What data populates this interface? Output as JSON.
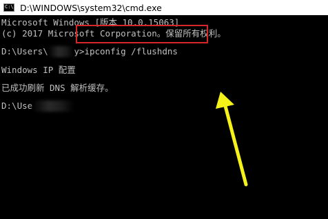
{
  "window": {
    "title": "D:\\WINDOWS\\system32\\cmd.exe",
    "icon": "cmd-icon"
  },
  "console": {
    "header_line1": "Microsoft Windows [版本 10.0.15063]",
    "header_line2": "(c) 2017 Microsoft Corporation。保留所有权利。",
    "prompt1_prefix": "D:\\Users\\",
    "prompt1_suffix": "y>",
    "command": "ipconfig /flushdns",
    "output_line1": "Windows IP 配置",
    "output_line2": "已成功刷新 DNS 解析缓存。",
    "prompt2_prefix": "D:\\Use"
  },
  "colors": {
    "background": "#000000",
    "text": "#c0c0c0",
    "highlight_box": "#d6262a",
    "arrow": "#f5f21a"
  }
}
